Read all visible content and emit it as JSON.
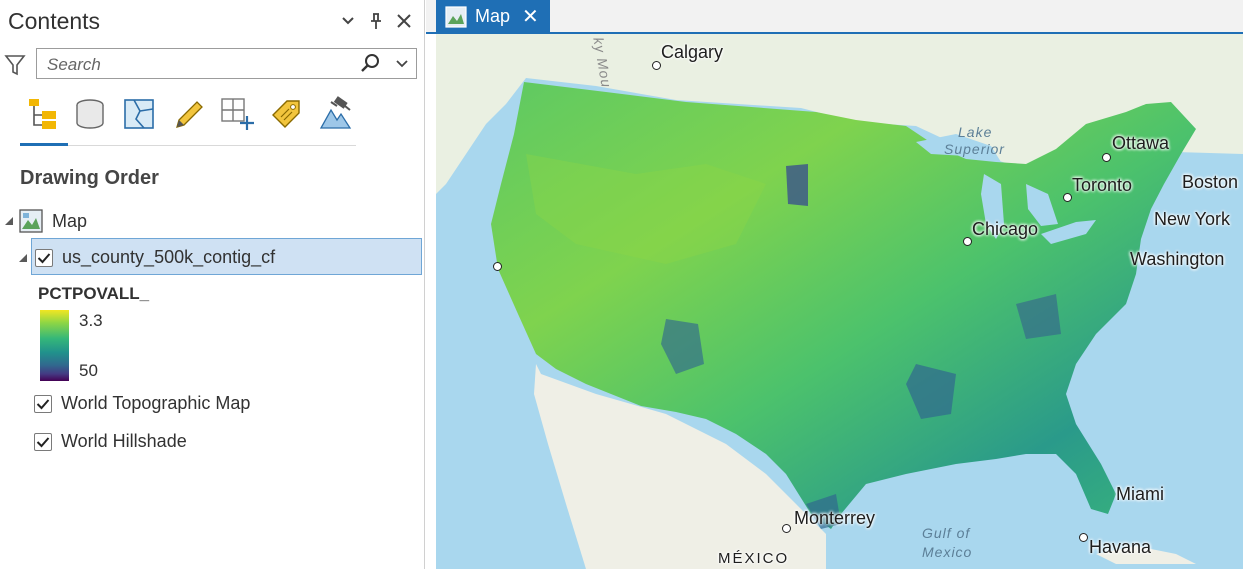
{
  "contents": {
    "title": "Contents",
    "search_placeholder": "Search",
    "section_heading": "Drawing Order",
    "tools": [
      "list-by-drawing-order-icon",
      "list-by-source-icon",
      "list-by-selection-icon",
      "list-by-editing-icon",
      "list-by-snapping-icon",
      "list-by-labeling-icon",
      "list-by-perspective-imagery-icon"
    ],
    "map_node": "Map",
    "layers": [
      {
        "name": "us_county_500k_contig_cf",
        "checked": true,
        "selected": true
      },
      {
        "name": "World Topographic Map",
        "checked": true,
        "selected": false
      },
      {
        "name": "World Hillshade",
        "checked": true,
        "selected": false
      }
    ],
    "legend": {
      "field": "PCTPOVALL_",
      "high_label": "3.3",
      "low_label": "50"
    }
  },
  "map_tab": {
    "label": "Map"
  },
  "map_labels": {
    "calgary": "Calgary",
    "ottawa": "Ottawa",
    "toronto": "Toronto",
    "boston": "Boston",
    "new_york": "New York",
    "washington": "Washington",
    "chicago": "Chicago",
    "miami": "Miami",
    "monterrey": "Monterrey",
    "havana": "Havana",
    "mexico": "MÉXICO",
    "lake_superior_1": "Lake",
    "lake_superior_2": "Superior",
    "gulf_1": "Gulf of",
    "gulf_2": "Mexico",
    "rocky": "ky Mou"
  },
  "colors": {
    "accent": "#1f6fb5",
    "selection": "#cfe1f3",
    "ramp_high": "#f2e622",
    "ramp_low": "#440154"
  }
}
